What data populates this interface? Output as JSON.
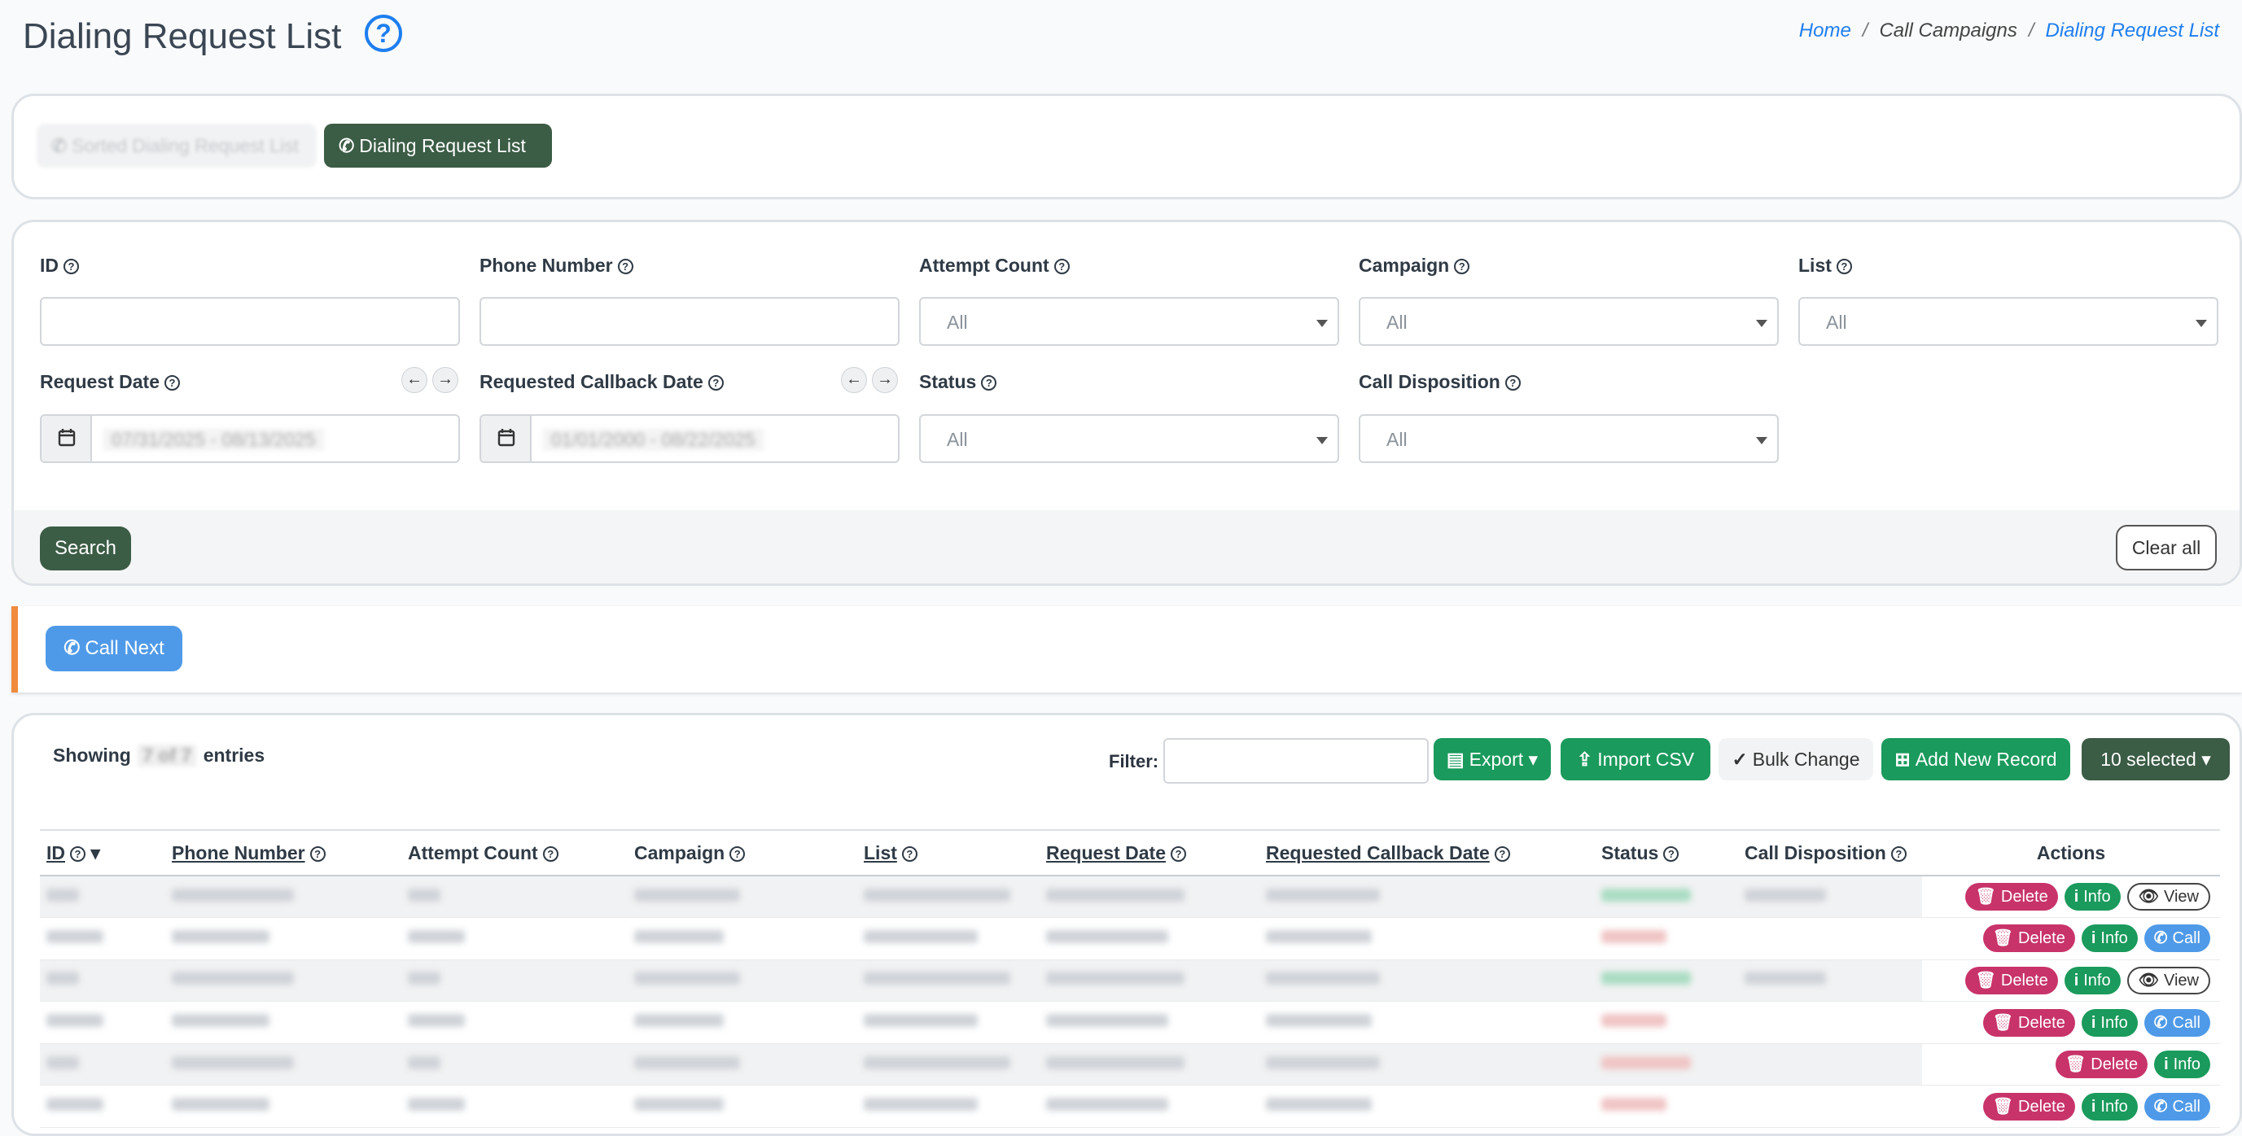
{
  "page": {
    "title": "Dialing Request List",
    "breadcrumb": {
      "home": "Home",
      "section": "Call Campaigns",
      "current": "Dialing Request List"
    }
  },
  "tabs": [
    {
      "label": "Sorted Dialing Request List",
      "active": false
    },
    {
      "label": "Dialing Request List",
      "active": true
    }
  ],
  "filters": {
    "id": {
      "label": "ID",
      "value": ""
    },
    "phone_number": {
      "label": "Phone Number",
      "value": ""
    },
    "attempt_count": {
      "label": "Attempt Count",
      "value": "All"
    },
    "campaign": {
      "label": "Campaign",
      "value": "All"
    },
    "list": {
      "label": "List",
      "value": "All"
    },
    "request_date": {
      "label": "Request Date",
      "value": "07/31/2025 - 08/13/2025"
    },
    "requested_callback_date": {
      "label": "Requested Callback Date",
      "value": "01/01/2000 - 08/22/2025"
    },
    "status": {
      "label": "Status",
      "value": "All"
    },
    "call_disposition": {
      "label": "Call Disposition",
      "value": "All"
    },
    "search_label": "Search",
    "clear_label": "Clear all"
  },
  "call_next": {
    "label": "Call Next"
  },
  "table_toolbar": {
    "showing_prefix": "Showing",
    "showing_count": "7 of 7",
    "showing_suffix": "entries",
    "filter_label": "Filter:",
    "filter_value": "",
    "export_label": "Export",
    "import_label": "Import CSV",
    "bulk_label": "Bulk Change",
    "add_label": "Add New Record",
    "selected_label": "10 selected"
  },
  "table": {
    "columns": [
      "ID",
      "Phone Number",
      "Attempt Count",
      "Campaign",
      "List",
      "Request Date",
      "Requested Callback Date",
      "Status",
      "Call Disposition",
      "Actions"
    ],
    "action_labels": {
      "delete": "Delete",
      "info": "Info",
      "view": "View",
      "call": "Call"
    },
    "rows": [
      {
        "third": "view"
      },
      {
        "third": "call"
      },
      {
        "third": "view"
      },
      {
        "third": "call"
      },
      {
        "third": ""
      },
      {
        "third": "call"
      }
    ]
  },
  "colors": {
    "primary_dark": "#3b5c45",
    "accent_blue": "#1e7ef0",
    "success": "#1a9a5c",
    "danger": "#c8336a",
    "call_blue": "#4f9ae8",
    "warning_bar": "#f08a3e"
  },
  "icons": [
    "help-circle-icon",
    "phone-icon",
    "calendar-icon",
    "arrow-left-icon",
    "arrow-right-icon",
    "file-excel-icon",
    "upload-icon",
    "check-icon",
    "file-plus-icon",
    "trash-icon",
    "info-icon",
    "eye-icon",
    "sort-desc-icon",
    "caret-down-icon"
  ]
}
